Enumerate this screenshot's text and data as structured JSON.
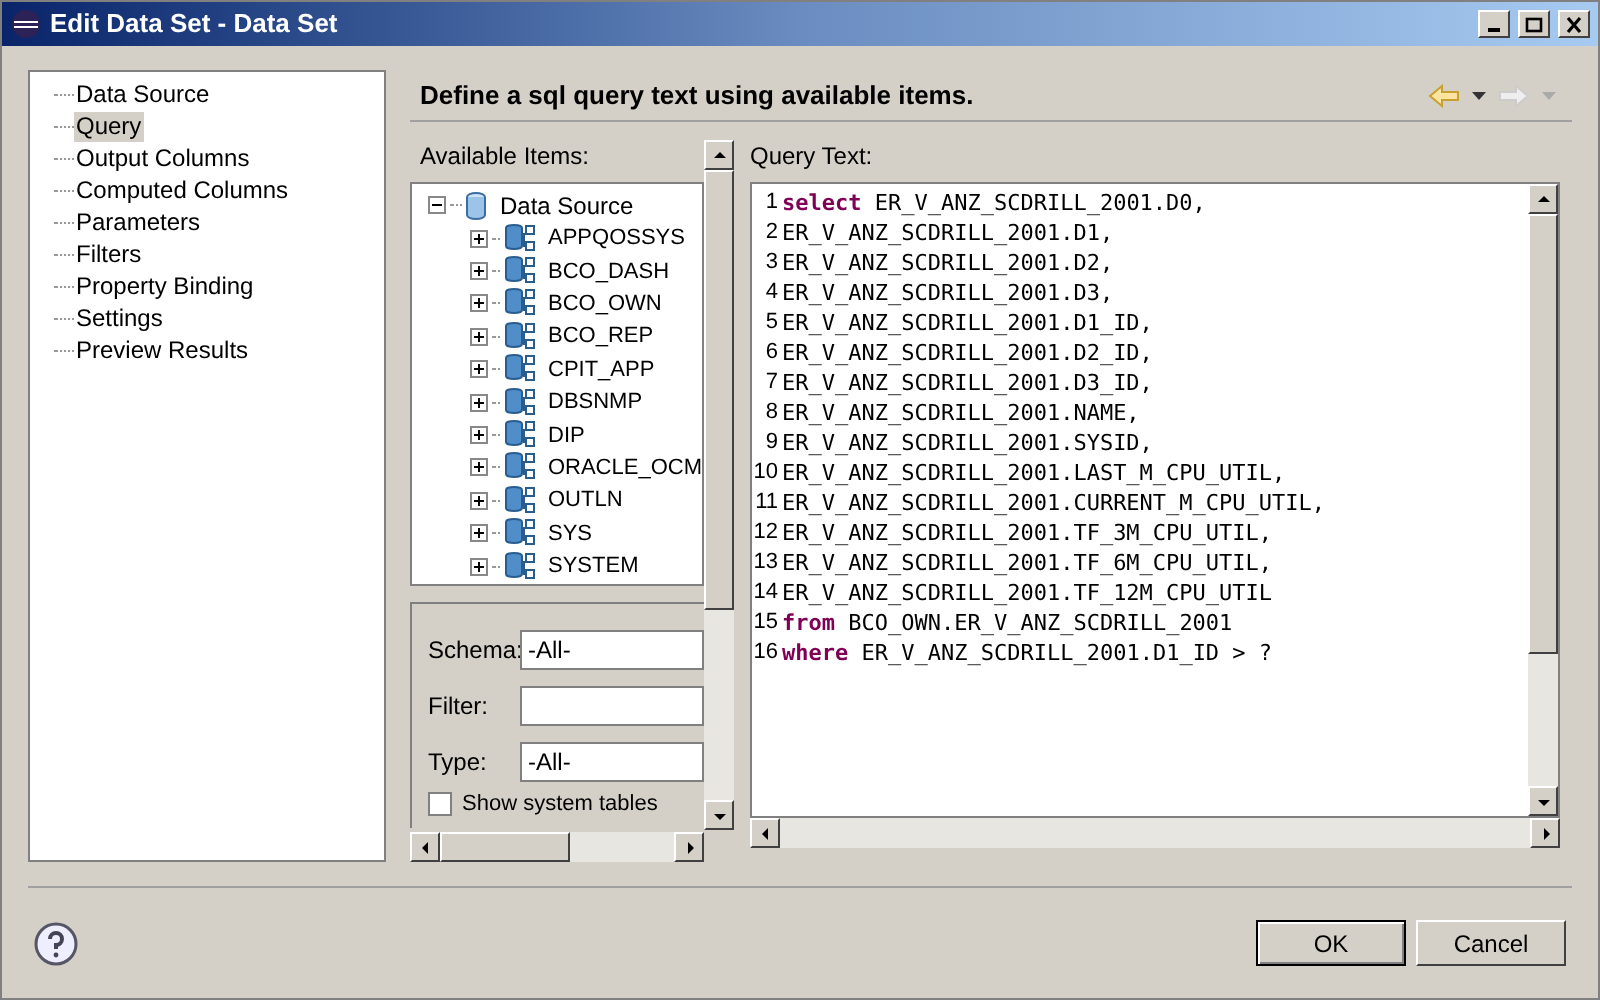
{
  "window": {
    "title": "Edit Data Set - Data Set"
  },
  "nav": {
    "items": [
      {
        "label": "Data Source",
        "selected": false
      },
      {
        "label": "Query",
        "selected": true
      },
      {
        "label": "Output Columns",
        "selected": false
      },
      {
        "label": "Computed Columns",
        "selected": false
      },
      {
        "label": "Parameters",
        "selected": false
      },
      {
        "label": "Filters",
        "selected": false
      },
      {
        "label": "Property Binding",
        "selected": false
      },
      {
        "label": "Settings",
        "selected": false
      },
      {
        "label": "Preview Results",
        "selected": false
      }
    ]
  },
  "header": {
    "title": "Define a sql query text using available items."
  },
  "available_items": {
    "label": "Available Items:",
    "tree": {
      "label": "Data Source",
      "expanded": true,
      "children": [
        {
          "label": "APPQOSSYS",
          "expanded": false
        },
        {
          "label": "BCO_DASH",
          "expanded": false
        },
        {
          "label": "BCO_OWN",
          "expanded": false
        },
        {
          "label": "BCO_REP",
          "expanded": false
        },
        {
          "label": "CPIT_APP",
          "expanded": false
        },
        {
          "label": "DBSNMP",
          "expanded": false
        },
        {
          "label": "DIP",
          "expanded": false
        },
        {
          "label": "ORACLE_OCM",
          "expanded": false
        },
        {
          "label": "OUTLN",
          "expanded": false
        },
        {
          "label": "SYS",
          "expanded": false
        },
        {
          "label": "SYSTEM",
          "expanded": false
        }
      ]
    }
  },
  "filters": {
    "schema": {
      "label": "Schema:",
      "value": "-All-"
    },
    "filter": {
      "label": "Filter:"
    },
    "type": {
      "label": "Type:",
      "value": "-All-"
    },
    "show_system_tables": {
      "label": "Show system tables",
      "checked": false
    }
  },
  "query": {
    "label": "Query Text:",
    "lines": [
      {
        "number": "1",
        "keyword": "select",
        "text": "ER_V_ANZ_SCDRILL_2001.D0,"
      },
      {
        "number": "2",
        "text": "ER_V_ANZ_SCDRILL_2001.D1,"
      },
      {
        "number": "3",
        "text": "ER_V_ANZ_SCDRILL_2001.D2,"
      },
      {
        "number": "4",
        "text": "ER_V_ANZ_SCDRILL_2001.D3,"
      },
      {
        "number": "5",
        "text": "ER_V_ANZ_SCDRILL_2001.D1_ID,"
      },
      {
        "number": "6",
        "text": "ER_V_ANZ_SCDRILL_2001.D2_ID,"
      },
      {
        "number": "7",
        "text": "ER_V_ANZ_SCDRILL_2001.D3_ID,"
      },
      {
        "number": "8",
        "text": "ER_V_ANZ_SCDRILL_2001.NAME,"
      },
      {
        "number": "9",
        "text": "ER_V_ANZ_SCDRILL_2001.SYSID,"
      },
      {
        "number": "10",
        "text": "ER_V_ANZ_SCDRILL_2001.LAST_M_CPU_UTIL,"
      },
      {
        "number": "11",
        "text": "ER_V_ANZ_SCDRILL_2001.CURRENT_M_CPU_UTIL,"
      },
      {
        "number": "12",
        "text": "ER_V_ANZ_SCDRILL_2001.TF_3M_CPU_UTIL,"
      },
      {
        "number": "13",
        "text": "ER_V_ANZ_SCDRILL_2001.TF_6M_CPU_UTIL,"
      },
      {
        "number": "14",
        "text": "ER_V_ANZ_SCDRILL_2001.TF_12M_CPU_UTIL"
      },
      {
        "number": "15",
        "keyword": "from",
        "text": "BCO_OWN.ER_V_ANZ_SCDRILL_2001"
      },
      {
        "number": "16",
        "keyword": "where",
        "text": "ER_V_ANZ_SCDRILL_2001.D1_ID > ?"
      }
    ]
  },
  "buttons": [
    {
      "label": "OK",
      "default": true
    },
    {
      "label": "Cancel",
      "default": false
    }
  ]
}
